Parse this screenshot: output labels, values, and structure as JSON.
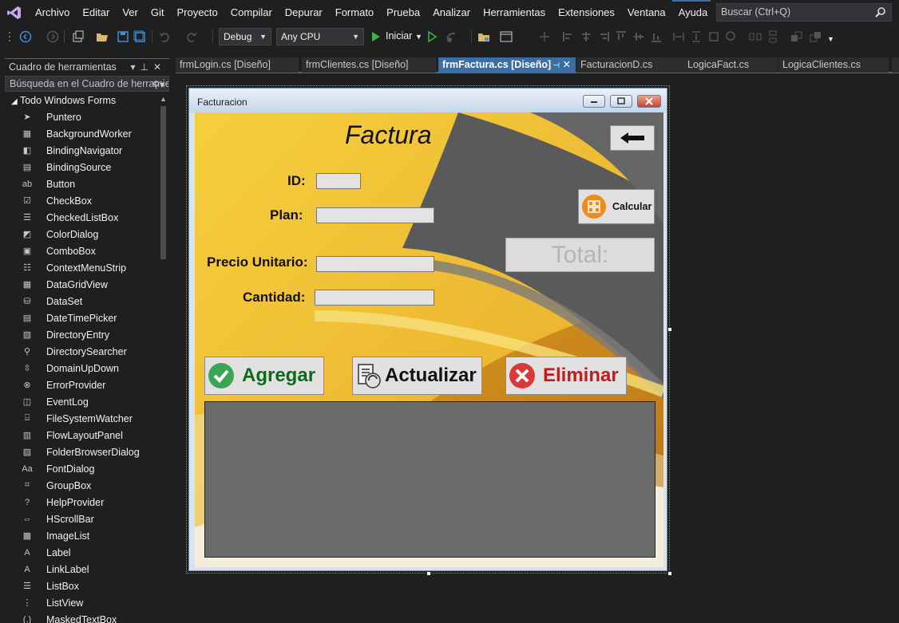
{
  "menu": [
    "Archivo",
    "Editar",
    "Ver",
    "Git",
    "Proyecto",
    "Compilar",
    "Depurar",
    "Formato",
    "Prueba",
    "Analizar",
    "Herramientas",
    "Extensiones",
    "Ventana",
    "Ayuda"
  ],
  "search": {
    "placeholder": "Buscar (Ctrl+Q)"
  },
  "toolbar": {
    "config": "Debug",
    "platform": "Any CPU",
    "start_label": "Iniciar"
  },
  "toolbox": {
    "title": "Cuadro de herramientas",
    "search_placeholder": "Búsqueda en el Cuadro de herramientas",
    "group": "Todo Windows Forms",
    "items": [
      {
        "label": "Puntero",
        "icon": "pointer-icon"
      },
      {
        "label": "BackgroundWorker",
        "icon": "backgroundworker-icon"
      },
      {
        "label": "BindingNavigator",
        "icon": "bindingnavigator-icon"
      },
      {
        "label": "BindingSource",
        "icon": "bindingsource-icon"
      },
      {
        "label": "Button",
        "icon": "button-icon"
      },
      {
        "label": "CheckBox",
        "icon": "checkbox-icon"
      },
      {
        "label": "CheckedListBox",
        "icon": "checkedlistbox-icon"
      },
      {
        "label": "ColorDialog",
        "icon": "colordialog-icon"
      },
      {
        "label": "ComboBox",
        "icon": "combobox-icon"
      },
      {
        "label": "ContextMenuStrip",
        "icon": "contextmenustrip-icon"
      },
      {
        "label": "DataGridView",
        "icon": "datagridview-icon"
      },
      {
        "label": "DataSet",
        "icon": "dataset-icon"
      },
      {
        "label": "DateTimePicker",
        "icon": "datetimepicker-icon"
      },
      {
        "label": "DirectoryEntry",
        "icon": "directoryentry-icon"
      },
      {
        "label": "DirectorySearcher",
        "icon": "directorysearcher-icon"
      },
      {
        "label": "DomainUpDown",
        "icon": "domainupdown-icon"
      },
      {
        "label": "ErrorProvider",
        "icon": "errorprovider-icon"
      },
      {
        "label": "EventLog",
        "icon": "eventlog-icon"
      },
      {
        "label": "FileSystemWatcher",
        "icon": "filesystemwatcher-icon"
      },
      {
        "label": "FlowLayoutPanel",
        "icon": "flowlayoutpanel-icon"
      },
      {
        "label": "FolderBrowserDialog",
        "icon": "folderbrowserdialog-icon"
      },
      {
        "label": "FontDialog",
        "icon": "fontdialog-icon"
      },
      {
        "label": "GroupBox",
        "icon": "groupbox-icon"
      },
      {
        "label": "HelpProvider",
        "icon": "helpprovider-icon"
      },
      {
        "label": "HScrollBar",
        "icon": "hscrollbar-icon"
      },
      {
        "label": "ImageList",
        "icon": "imagelist-icon"
      },
      {
        "label": "Label",
        "icon": "label-icon"
      },
      {
        "label": "LinkLabel",
        "icon": "linklabel-icon"
      },
      {
        "label": "ListBox",
        "icon": "listbox-icon"
      },
      {
        "label": "ListView",
        "icon": "listview-icon"
      },
      {
        "label": "MaskedTextBox",
        "icon": "maskedtextbox-icon"
      }
    ]
  },
  "tabs": [
    {
      "label": "frmLogin.cs [Diseño]",
      "active": false
    },
    {
      "label": "frmClientes.cs [Diseño]",
      "active": false
    },
    {
      "label": "frmFactura.cs [Diseño]",
      "active": true
    },
    {
      "label": "FacturacionD.cs",
      "active": false
    },
    {
      "label": "LogicaFact.cs",
      "active": false
    },
    {
      "label": "LogicaClientes.cs",
      "active": false
    }
  ],
  "form": {
    "window_title": "Facturacion",
    "heading": "Factura",
    "labels": {
      "id": "ID:",
      "plan": "Plan:",
      "precio": "Precio Unitario:",
      "cantidad": "Cantidad:"
    },
    "calcular": "Calcular",
    "total": "Total:",
    "agregar": "Agregar",
    "actualizar": "Actualizar",
    "eliminar": "Eliminar"
  },
  "colors": {
    "accent": "#3a6ea5",
    "agregar_text": "#0b6b1a",
    "eliminar_text": "#c41a1a",
    "form_yellow": "#f3c332",
    "swoosh_gray": "#595959"
  }
}
